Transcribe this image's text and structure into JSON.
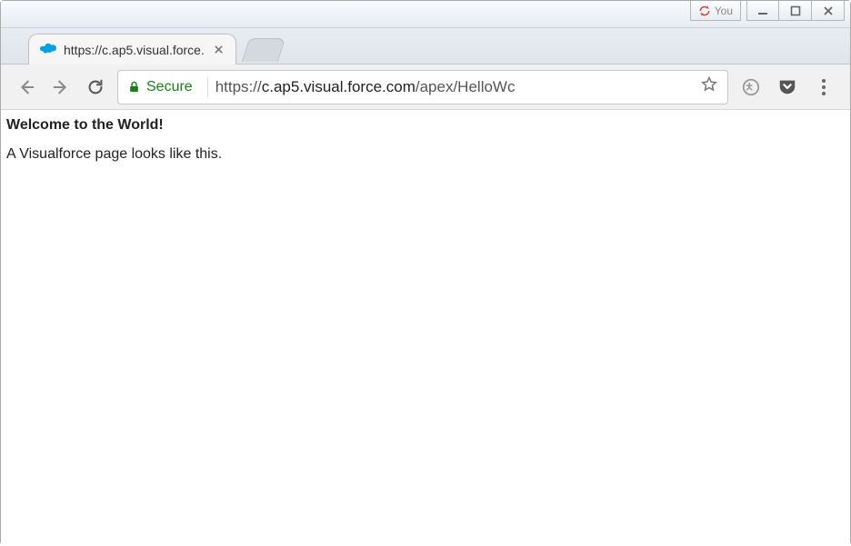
{
  "window": {
    "you_label": "You"
  },
  "tab": {
    "title": "https://c.ap5.visual.force."
  },
  "addressbar": {
    "secure_label": "Secure",
    "url_scheme": "https://",
    "url_domain": "c.ap5.visual.force.com",
    "url_path": "/apex/HelloWc"
  },
  "page": {
    "heading": "Welcome to the World!",
    "paragraph": "A Visualforce page looks like this."
  }
}
